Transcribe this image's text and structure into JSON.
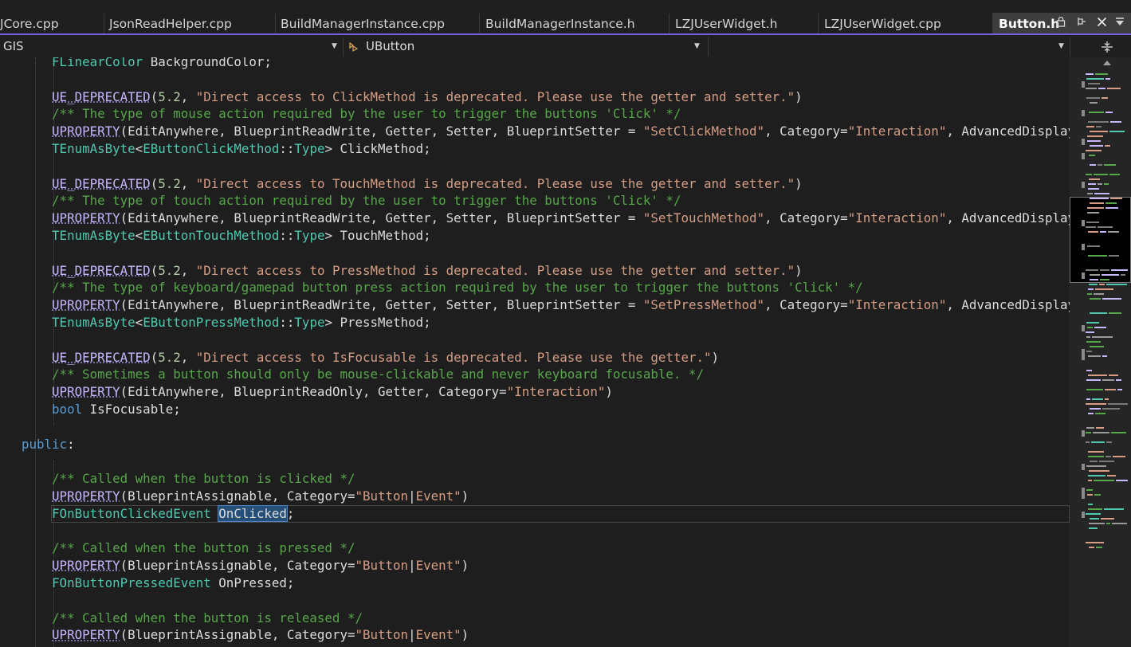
{
  "tabs": [
    {
      "label": "JCore.cpp"
    },
    {
      "label": "JsonReadHelper.cpp"
    },
    {
      "label": "BuildManagerInstance.cpp"
    },
    {
      "label": "BuildManagerInstance.h"
    },
    {
      "label": "LZJUserWidget.h"
    },
    {
      "label": "LZJUserWidget.cpp"
    }
  ],
  "active_tab": {
    "label": "Button.h",
    "lock_icon": "lock-icon",
    "pin_icon": "pin-icon",
    "close_icon": "close-icon"
  },
  "overflow_icon": "tab-overflow-icon",
  "navbar": {
    "project": "GIS",
    "scope": "UButton",
    "member": "",
    "scope_icon": "class-icon"
  },
  "accent_color": "#7160e8",
  "code_lines": [
    "    FLinearColor BackgroundColor;",
    "",
    "    UE_DEPRECATED(5.2, \"Direct access to ClickMethod is deprecated. Please use the getter and setter.\")",
    "    /** The type of mouse action required by the user to trigger the buttons 'Click' */",
    "    UPROPERTY(EditAnywhere, BlueprintReadWrite, Getter, Setter, BlueprintSetter = \"SetClickMethod\", Category=\"Interaction\", AdvancedDisplay)",
    "    TEnumAsByte<EButtonClickMethod::Type> ClickMethod;",
    "",
    "    UE_DEPRECATED(5.2, \"Direct access to TouchMethod is deprecated. Please use the getter and setter.\")",
    "    /** The type of touch action required by the user to trigger the buttons 'Click' */",
    "    UPROPERTY(EditAnywhere, BlueprintReadWrite, Getter, Setter, BlueprintSetter = \"SetTouchMethod\", Category=\"Interaction\", AdvancedDisplay)",
    "    TEnumAsByte<EButtonTouchMethod::Type> TouchMethod;",
    "",
    "    UE_DEPRECATED(5.2, \"Direct access to PressMethod is deprecated. Please use the getter and setter.\")",
    "    /** The type of keyboard/gamepad button press action required by the user to trigger the buttons 'Click' */",
    "    UPROPERTY(EditAnywhere, BlueprintReadWrite, Getter, Setter, BlueprintSetter = \"SetPressMethod\", Category=\"Interaction\", AdvancedDisplay)",
    "    TEnumAsByte<EButtonPressMethod::Type> PressMethod;",
    "",
    "    UE_DEPRECATED(5.2, \"Direct access to IsFocusable is deprecated. Please use the getter.\")",
    "    /** Sometimes a button should only be mouse-clickable and never keyboard focusable. */",
    "    UPROPERTY(EditAnywhere, BlueprintReadOnly, Getter, Category=\"Interaction\")",
    "    bool IsFocusable;",
    "",
    "public:",
    "",
    "    /** Called when the button is clicked */",
    "    UPROPERTY(BlueprintAssignable, Category=\"Button|Event\")",
    "    FOnButtonClickedEvent OnClicked;",
    "",
    "    /** Called when the button is pressed */",
    "    UPROPERTY(BlueprintAssignable, Category=\"Button|Event\")",
    "    FOnButtonPressedEvent OnPressed;",
    "",
    "    /** Called when the button is released */",
    "    UPROPERTY(BlueprintAssignable, Category=\"Button|Event\")"
  ],
  "selected_word": "OnClicked",
  "current_line_index": 26
}
